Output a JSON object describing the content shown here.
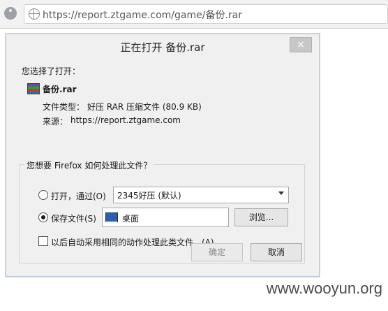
{
  "browser": {
    "url": "https://report.ztgame.com/game/备份.rar"
  },
  "dialog": {
    "title": "正在打开 备份.rar",
    "close_label": "×",
    "selected_prompt": "您选择了打开：",
    "file_name": "备份.rar",
    "file_type_label": "文件类型：",
    "file_type_value": "好压 RAR 压缩文件 (80.9 KB)",
    "source_label": "来源：",
    "source_value": "https://report.ztgame.com",
    "question": "您想要 Firefox 如何处理此文件？",
    "open_with_label": "打开，通过(O)",
    "open_with_app": "2345好压 (默认)",
    "save_file_label": "保存文件(S)",
    "save_location": "桌面",
    "browse_button": "浏览...",
    "auto_checkbox_label": "以后自动采用相同的动作处理此类文件。(A)",
    "ok_button": "确定",
    "cancel_button": "取消"
  },
  "watermark": "www.wooyun.org"
}
